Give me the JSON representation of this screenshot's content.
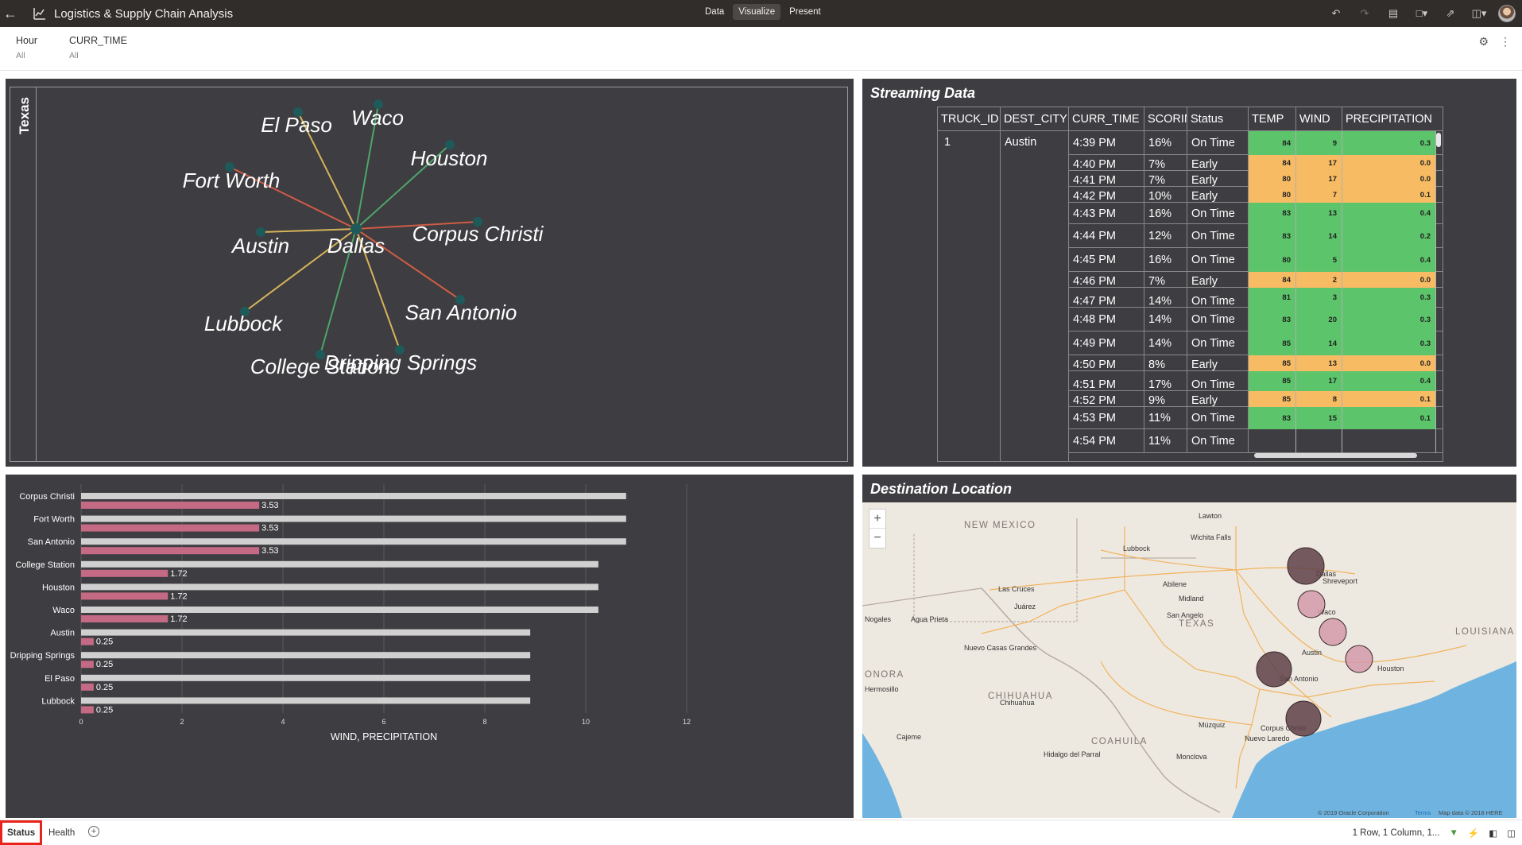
{
  "app": {
    "title": "Logistics & Supply Chain Analysis",
    "modes": [
      "Data",
      "Visualize",
      "Present"
    ],
    "active_mode": "Visualize"
  },
  "filters": [
    {
      "name": "Hour",
      "value": "All"
    },
    {
      "name": "CURR_TIME",
      "value": "All"
    }
  ],
  "network": {
    "row_label": "Texas",
    "center": "Dallas",
    "nodes": [
      {
        "name": "El Paso",
        "color": "#d6b45a"
      },
      {
        "name": "Waco",
        "color": "#4ea56a"
      },
      {
        "name": "Houston",
        "color": "#4ea56a"
      },
      {
        "name": "Fort Worth",
        "color": "#cf5c45"
      },
      {
        "name": "Corpus Christi",
        "color": "#cf5c45"
      },
      {
        "name": "Austin",
        "color": "#d6b45a"
      },
      {
        "name": "San Antonio",
        "color": "#cf5c45"
      },
      {
        "name": "Lubbock",
        "color": "#d6b45a"
      },
      {
        "name": "College Station",
        "color": "#4ea56a"
      },
      {
        "name": "Dripping Springs",
        "color": "#d6b45a"
      }
    ],
    "node_color": "#1e5a5a"
  },
  "stream": {
    "title": "Streaming Data",
    "columns": [
      "TRUCK_ID",
      "DEST_CITY",
      "CURR_TIME",
      "SCORIN",
      "Status",
      "TEMP",
      "WIND",
      "PRECIPITATION"
    ],
    "truck_id": "1",
    "dest_city": "Austin",
    "rows": [
      {
        "time": "4:39 PM",
        "score": "16%",
        "status": "On Time",
        "temp": "84",
        "wind": "9",
        "precip": "0.3"
      },
      {
        "time": "4:40 PM",
        "score": "7%",
        "status": "Early",
        "temp": "84",
        "wind": "17",
        "precip": "0.0"
      },
      {
        "time": "4:41 PM",
        "score": "7%",
        "status": "Early",
        "temp": "80",
        "wind": "17",
        "precip": "0.0"
      },
      {
        "time": "4:42 PM",
        "score": "10%",
        "status": "Early",
        "temp": "80",
        "wind": "7",
        "precip": "0.1"
      },
      {
        "time": "4:43 PM",
        "score": "16%",
        "status": "On Time",
        "temp": "83",
        "wind": "13",
        "precip": "0.4"
      },
      {
        "time": "4:44 PM",
        "score": "12%",
        "status": "On Time",
        "temp": "83",
        "wind": "14",
        "precip": "0.2"
      },
      {
        "time": "4:45 PM",
        "score": "16%",
        "status": "On Time",
        "temp": "80",
        "wind": "5",
        "precip": "0.4"
      },
      {
        "time": "4:46 PM",
        "score": "7%",
        "status": "Early",
        "temp": "84",
        "wind": "2",
        "precip": "0.0"
      },
      {
        "time": "4:47 PM",
        "score": "14%",
        "status": "On Time",
        "temp": "81",
        "wind": "3",
        "precip": "0.3"
      },
      {
        "time": "4:48 PM",
        "score": "14%",
        "status": "On Time",
        "temp": "83",
        "wind": "20",
        "precip": "0.3"
      },
      {
        "time": "4:49 PM",
        "score": "14%",
        "status": "On Time",
        "temp": "85",
        "wind": "14",
        "precip": "0.3"
      },
      {
        "time": "4:50 PM",
        "score": "8%",
        "status": "Early",
        "temp": "85",
        "wind": "13",
        "precip": "0.0"
      },
      {
        "time": "4:51 PM",
        "score": "17%",
        "status": "On Time",
        "temp": "85",
        "wind": "17",
        "precip": "0.4"
      },
      {
        "time": "4:52 PM",
        "score": "9%",
        "status": "Early",
        "temp": "85",
        "wind": "8",
        "precip": "0.1"
      },
      {
        "time": "4:53 PM",
        "score": "11%",
        "status": "On Time",
        "temp": "83",
        "wind": "15",
        "precip": "0.1"
      },
      {
        "time": "4:54 PM",
        "score": "11%",
        "status": "On Time",
        "temp": "",
        "wind": "",
        "precip": ""
      }
    ],
    "colors": {
      "on_time": "#5cc46a",
      "early": "#f7bc63"
    }
  },
  "chart_data": {
    "type": "bar",
    "xlabel": "WIND, PRECIPITATION",
    "xlim": [
      0,
      12
    ],
    "xticks": [
      "0",
      "2",
      "4",
      "6",
      "8",
      "10",
      "12"
    ],
    "categories": [
      "Corpus Christi",
      "Fort Worth",
      "San Antonio",
      "College Station",
      "Houston",
      "Waco",
      "Austin",
      "Dripping Springs",
      "El Paso",
      "Lubbock"
    ],
    "series": [
      {
        "values": [
          10.8,
          10.8,
          10.8,
          10.25,
          10.25,
          10.25,
          8.9,
          8.9,
          8.9,
          8.9
        ],
        "color": "#d0d0d0"
      },
      {
        "values": [
          3.53,
          3.53,
          3.53,
          1.72,
          1.72,
          1.72,
          0.25,
          0.25,
          0.25,
          0.25
        ],
        "labels": [
          "3.53",
          "3.53",
          "3.53",
          "1.72",
          "1.72",
          "1.72",
          "0.25",
          "0.25",
          "0.25",
          "0.25"
        ],
        "color": "#c56a84"
      }
    ],
    "grid": true
  },
  "map": {
    "title": "Destination Location",
    "zoom_in": "+",
    "zoom_out": "−",
    "labels": [
      {
        "text": "Lawton"
      },
      {
        "text": "NEW MEXICO"
      },
      {
        "text": "Wichita Falls"
      },
      {
        "text": "Lubbock"
      },
      {
        "text": "Dallas"
      },
      {
        "text": "Shreveport"
      },
      {
        "text": "Abilene"
      },
      {
        "text": "Las Cruces"
      },
      {
        "text": "Juárez"
      },
      {
        "text": "Midland"
      },
      {
        "text": "Waco"
      },
      {
        "text": "San Angelo"
      },
      {
        "text": "TEXAS"
      },
      {
        "text": "Nogales"
      },
      {
        "text": "Agua Prieta"
      },
      {
        "text": "LOUISIANA"
      },
      {
        "text": "Austin"
      },
      {
        "text": "Nuevo Casas Grandes"
      },
      {
        "text": "Houston"
      },
      {
        "text": "ONORA"
      },
      {
        "text": "San Antonio"
      },
      {
        "text": "Hermosillo"
      },
      {
        "text": "CHIHUAHUA"
      },
      {
        "text": "Chihuahua"
      },
      {
        "text": "Múzquiz"
      },
      {
        "text": "Corpus Christi"
      },
      {
        "text": "Nuevo Laredo"
      },
      {
        "text": "Cajeme"
      },
      {
        "text": "COAHUILA"
      },
      {
        "text": "Hidalgo del Parral"
      },
      {
        "text": "Monclova"
      }
    ],
    "attribution": "© 2019 Oracle Corporation",
    "terms": "Terms",
    "mapdata": "Map data © 2018 HERE",
    "bubbles": [
      {
        "city": "Dallas",
        "color": "#5e3f47"
      },
      {
        "city": "Waco",
        "color": "#d49aaa"
      },
      {
        "city": "Austin",
        "color": "#d49aaa"
      },
      {
        "city": "Houston",
        "color": "#d49aaa"
      },
      {
        "city": "San Antonio",
        "color": "#5e3f47"
      },
      {
        "city": "Corpus Christi",
        "color": "#5e3f47"
      }
    ]
  },
  "bottom": {
    "tabs": [
      "Status",
      "Health"
    ],
    "active_tab": "Status",
    "layout_info": "1 Row, 1 Column, 1..."
  }
}
